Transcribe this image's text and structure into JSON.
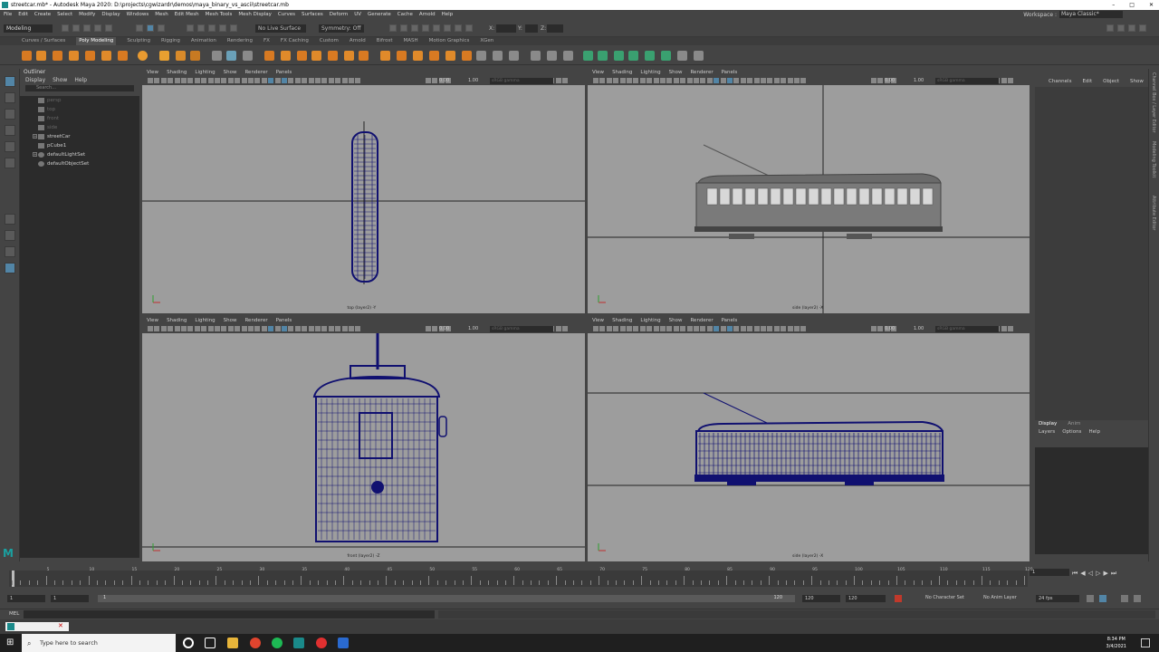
{
  "titlebar": {
    "title": "streetcar.mb* - Autodesk Maya 2020: D:\\projects\\cgwizardr\\demos\\maya_binary_vs_ascii\\streetcar.mb",
    "min": "–",
    "max": "□",
    "close": "✕"
  },
  "menubar": {
    "items": [
      "File",
      "Edit",
      "Create",
      "Select",
      "Modify",
      "Display",
      "Windows",
      "Mesh",
      "Edit Mesh",
      "Mesh Tools",
      "Mesh Display",
      "Curves",
      "Surfaces",
      "Deform",
      "UV",
      "Generate",
      "Cache",
      "Arnold",
      "Help"
    ]
  },
  "workspace": {
    "label": "Workspace :",
    "value": "Maya Classic*"
  },
  "statusline": {
    "mode": "Modeling",
    "live_surface": "No Live Surface",
    "symmetry": "Symmetry: Off",
    "x_label": "X:",
    "y_label": "Y:",
    "z_label": "Z:"
  },
  "shelf": {
    "tabs": [
      "Curves / Surfaces",
      "Poly Modeling",
      "Sculpting",
      "Rigging",
      "Animation",
      "Rendering",
      "FX",
      "FX Caching",
      "Custom",
      "Arnold",
      "Bifrost",
      "MASH",
      "Motion Graphics",
      "XGen"
    ],
    "active_tab": "Poly Modeling"
  },
  "outliner": {
    "title": "Outliner",
    "menu": [
      "Display",
      "Show",
      "Help"
    ],
    "search_placeholder": "Search...",
    "items": [
      {
        "label": "persp",
        "dim": true
      },
      {
        "label": "top",
        "dim": true
      },
      {
        "label": "front",
        "dim": true
      },
      {
        "label": "side",
        "dim": true
      },
      {
        "label": "streetCar",
        "dim": false,
        "expand": true
      },
      {
        "label": "pCube1",
        "dim": false
      },
      {
        "label": "defaultLightSet",
        "dim": false,
        "expand": true
      },
      {
        "label": "defaultObjectSet",
        "dim": false
      }
    ]
  },
  "viewport_menu": [
    "View",
    "Shading",
    "Lighting",
    "Show",
    "Renderer",
    "Panels"
  ],
  "viewports": {
    "top": {
      "camera": "top (layer2) -Y",
      "num1": "0.00",
      "num2": "1.00",
      "colorspace": "sRGB gamma"
    },
    "side_shaded": {
      "camera": "side (layer2) -X",
      "num1": "0.00",
      "num2": "1.00",
      "colorspace": "sRGB gamma"
    },
    "front": {
      "camera": "front (layer2) -Z",
      "num1": "0.00",
      "num2": "1.00",
      "colorspace": "sRGB gamma"
    },
    "side_wire": {
      "camera": "side (layer2) -X",
      "num1": "0.00",
      "num2": "1.00",
      "colorspace": "sRGB gamma"
    }
  },
  "channelbox": {
    "menu": [
      "Channels",
      "Edit",
      "Object",
      "Show"
    ]
  },
  "layer_panel": {
    "tabs": [
      "Display",
      "Anim"
    ],
    "menu": [
      "Layers",
      "Options",
      "Help"
    ]
  },
  "sidetabs": [
    "Channel Box / Layer Editor",
    "Modeling Toolkit",
    "Attribute Editor"
  ],
  "timeslider": {
    "labels": [
      "5",
      "10",
      "15",
      "20",
      "25",
      "30",
      "35",
      "40",
      "45",
      "50",
      "55",
      "60",
      "65",
      "70",
      "75",
      "80",
      "85",
      "90",
      "95",
      "100",
      "105",
      "110",
      "115",
      "120"
    ],
    "current_frame": "1"
  },
  "range": {
    "start": "1",
    "start2": "1",
    "current": "1",
    "end": "120",
    "end2": "120",
    "end3": "120",
    "char_set": "No Character Set",
    "anim_layer": "No Anim Layer",
    "fps": "24 fps"
  },
  "cmdline": {
    "label": "MEL"
  },
  "taskbar": {
    "search_placeholder": "Type here to search",
    "time": "8:34 PM",
    "date": "3/4/2021"
  },
  "colors": {
    "wire": "#101070",
    "viewport_bg": "#9d9d9d",
    "accent": "#5285a6"
  }
}
